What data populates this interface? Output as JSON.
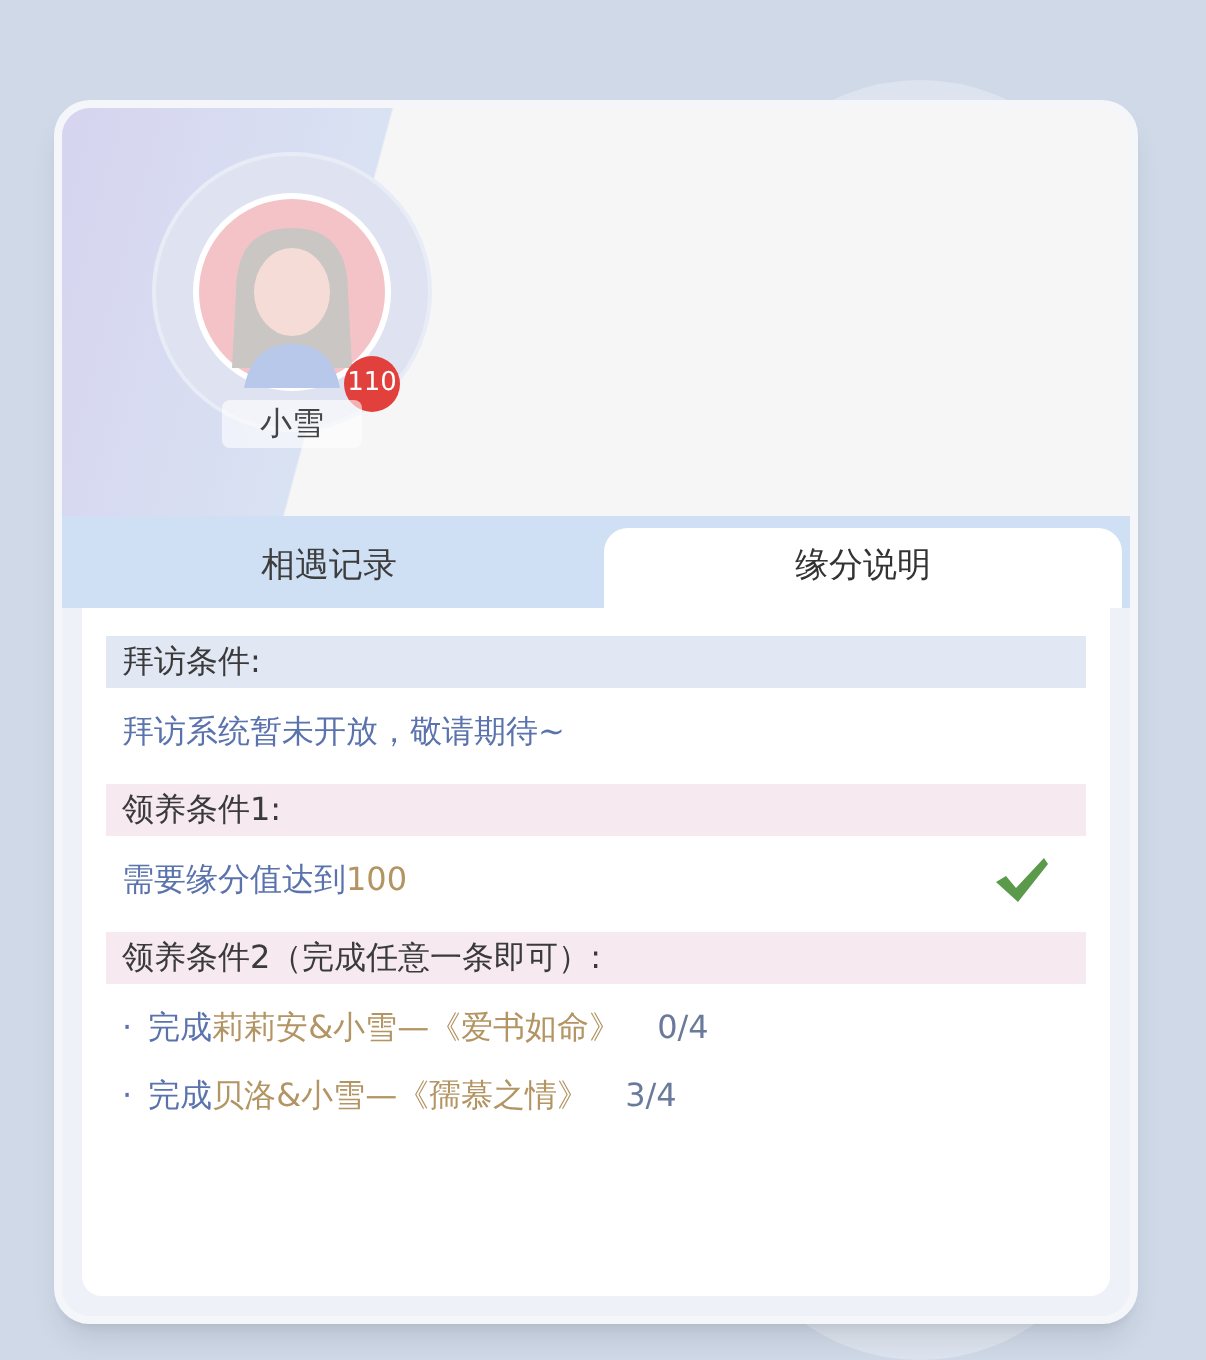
{
  "profile": {
    "name": "小雪",
    "badge": "110"
  },
  "tabs": [
    {
      "label": "相遇记录",
      "selected": false
    },
    {
      "label": "缘分说明",
      "selected": true
    }
  ],
  "sections": [
    {
      "heading": "拜访条件:",
      "color": "#e2e7f4",
      "items": [
        {
          "kind": "text",
          "text": "拜访系统暂未开放，敬请期待~"
        }
      ]
    },
    {
      "heading": "领养条件1:",
      "color": "#f6e9ef",
      "items": [
        {
          "kind": "requirement",
          "text": "需要缘分值达到",
          "value": "100",
          "done": true
        }
      ]
    },
    {
      "heading": "领养条件2（完成任意一条即可）:",
      "color": "#f6e9ef",
      "items": [
        {
          "kind": "task",
          "bullet": "·",
          "prefix": "完成",
          "target": "莉莉安&小雪—《爱书如命》",
          "progress": "0/4"
        },
        {
          "kind": "task",
          "bullet": "·",
          "prefix": "完成",
          "target": "贝洛&小雪—《孺慕之情》",
          "progress": "3/4"
        }
      ]
    }
  ]
}
